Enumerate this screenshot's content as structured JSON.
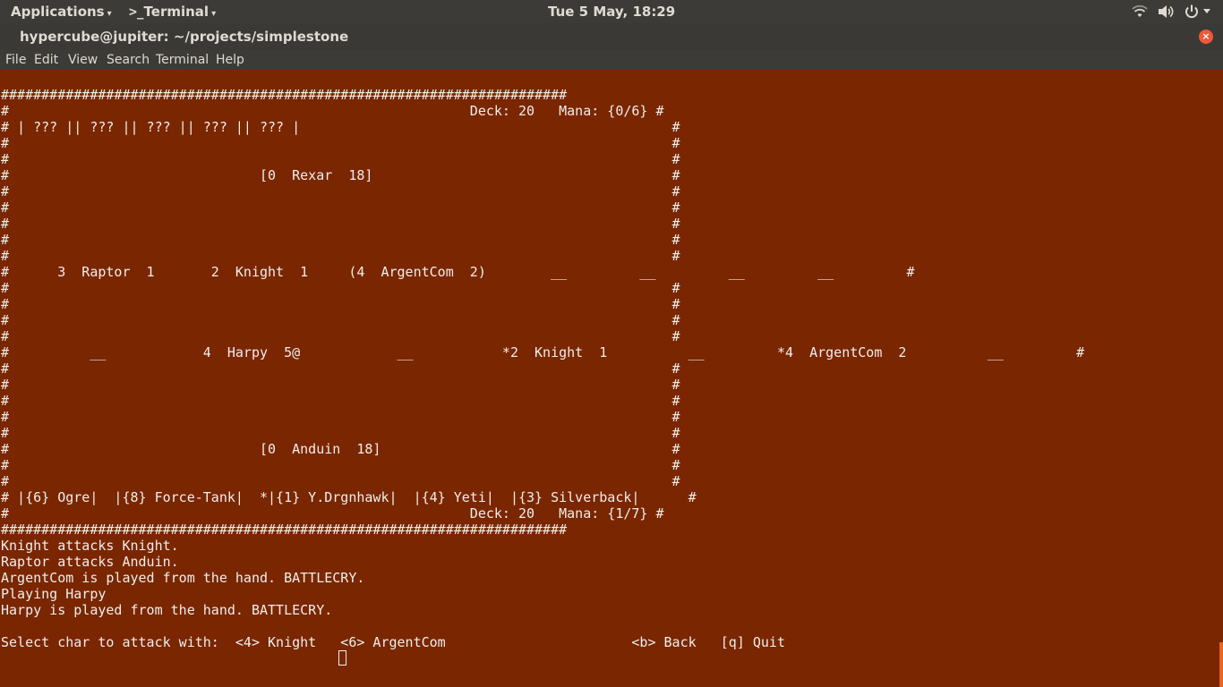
{
  "panel": {
    "applications_label": "Applications",
    "active_app_label": "_Terminal",
    "active_app_glyph": ">",
    "dropdown_arrow": "▾",
    "clock": "Tue  5 May, 18:29",
    "tray_icons": [
      "wifi-icon",
      "volume-icon",
      "power-icon"
    ]
  },
  "window": {
    "title": "hypercube@jupiter: ~/projects/simplestone",
    "close_glyph": "×"
  },
  "menubar": {
    "items": [
      "File",
      "Edit",
      "View",
      "Search",
      "Terminal",
      "Help"
    ]
  },
  "terminal": {
    "background": "#7a2600",
    "foreground": "#eeeeec",
    "lines": [
      "######################################################################",
      "#                                                         Deck: 20   Mana: {0/6} #",
      "# | ??? || ??? || ??? || ??? || ??? |                                              #",
      "#                                                                                  #",
      "#                                                                                  #",
      "#                               [0  Rexar  18]                                     #",
      "#                                                                                  #",
      "#                                                                                  #",
      "#                                                                                  #",
      "#                                                                                  #",
      "#                                                                                  #",
      "#      3  Raptor  1       2  Knight  1     (4  ArgentCom  2)        __         __         __         __         #",
      "#                                                                                  #",
      "#                                                                                  #",
      "#                                                                                  #",
      "#                                                                                  #",
      "#          __            4  Harpy  5@            __           *2  Knight  1          __         *4  ArgentCom  2          __         #",
      "#                                                                                  #",
      "#                                                                                  #",
      "#                                                                                  #",
      "#                                                                                  #",
      "#                                                                                  #",
      "#                               [0  Anduin  18]                                    #",
      "#                                                                                  #",
      "#                                                                                  #",
      "# |{6} Ogre|  |{8} Force-Tank|  *|{1} Y.Drgnhawk|  |{4} Yeti|  |{3} Silverback|      #",
      "#                                                         Deck: 20   Mana: {1/7} #",
      "######################################################################",
      "Knight attacks Knight.",
      "Raptor attacks Anduin.",
      "ArgentCom is played from the hand. BATTLECRY.",
      "Playing Harpy",
      "Harpy is played from the hand. BATTLECRY.",
      "",
      "Select char to attack with:  <4> Knight   <6> ArgentCom                       <b> Back   [q] Quit"
    ]
  }
}
